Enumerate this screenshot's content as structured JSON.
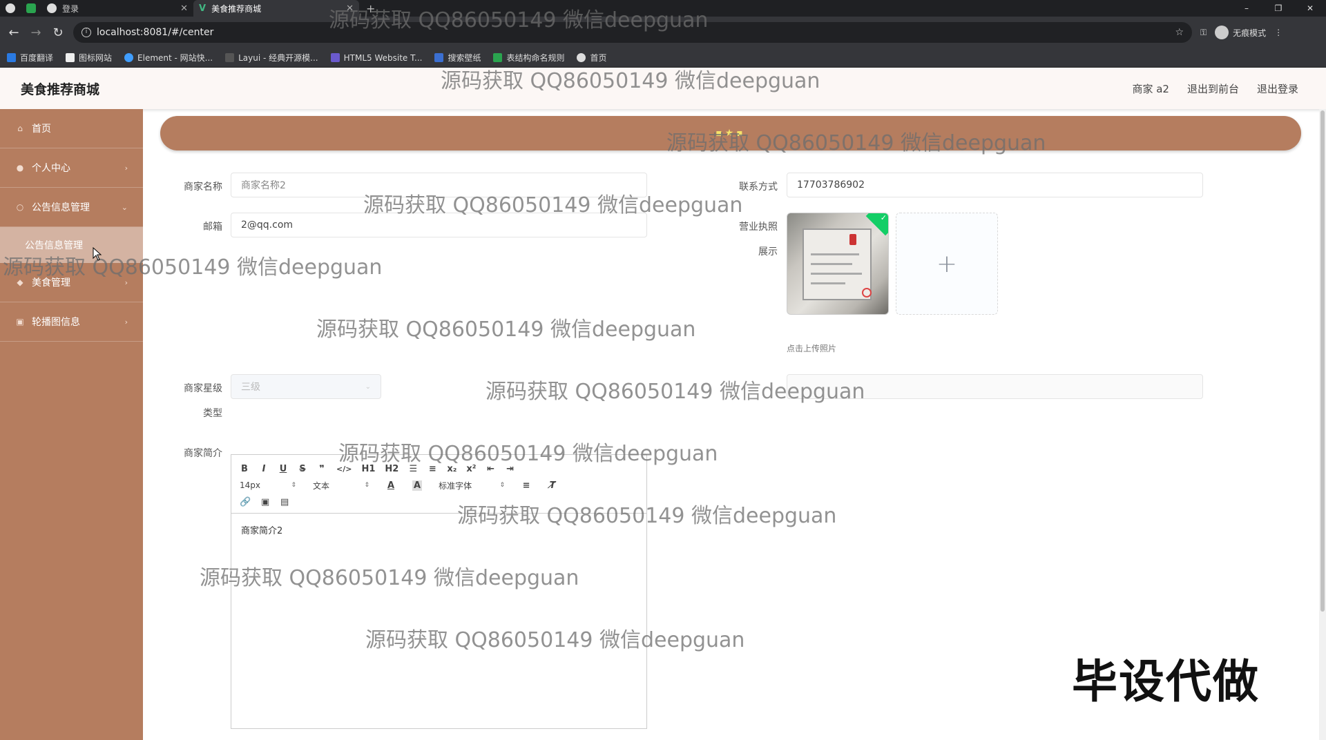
{
  "browser": {
    "tabs": [
      {
        "label": "",
        "icon": "browser-icon"
      },
      {
        "label": "",
        "icon": "sheet-icon"
      },
      {
        "label": "登录",
        "icon": "globe-icon"
      },
      {
        "label": "美食推荐商城",
        "icon": "vue-icon",
        "active": true
      }
    ],
    "new_tab": "+",
    "window_controls": [
      "–",
      "❐",
      "✕"
    ],
    "url": "localhost:8081/#/center",
    "incognito_label": "无痕模式",
    "bookmarks": [
      "百度翻译",
      "图标网站",
      "Element - 网站快...",
      "Layui - 经典开源模...",
      "HTML5 Website T...",
      "搜索壁纸",
      "表结构命名规则",
      "首页"
    ]
  },
  "app": {
    "title": "美食推荐商城",
    "header_links": [
      "商家 a2",
      "退出到前台",
      "退出登录"
    ]
  },
  "sidebar": {
    "items": [
      {
        "label": "首页",
        "icon": "home-icon"
      },
      {
        "label": "个人中心",
        "icon": "user-icon"
      },
      {
        "label": "公告信息管理",
        "icon": "notice-icon"
      },
      {
        "label": "公告信息管理",
        "sub": true
      },
      {
        "label": "美食管理",
        "icon": "food-icon"
      },
      {
        "label": "轮播图信息",
        "icon": "image-icon"
      }
    ]
  },
  "form": {
    "merchant_name_label": "商家名称",
    "merchant_name_value": "商家名称2",
    "contact_label": "联系方式",
    "contact_value": "17703786902",
    "email_label": "邮箱",
    "email_value": "2@qq.com",
    "license_label_1": "营业执照",
    "license_label_2": "展示",
    "upload_tip": "点击上传照片",
    "level_label_1": "商家星级",
    "level_label_2": "类型",
    "level_value": "三级",
    "intro_label": "商家简介",
    "intro_content": "商家简介2"
  },
  "editor": {
    "row1": [
      "B",
      "I",
      "U",
      "S",
      "❞",
      "</>",
      "H1",
      "H2",
      "☰",
      "≡",
      "x₂",
      "x²",
      "⇤",
      "⇥"
    ],
    "font_size": "14px",
    "text_type": "文本",
    "font_family": "标准字体",
    "row3": [
      "🔗",
      "▣",
      "▤"
    ]
  },
  "watermark": "源码获取 QQ86050149 微信deepguan",
  "bigmark": "毕设代做",
  "colors": {
    "primary": "#b57d5f",
    "sidebar_sub": "#d4b3a2",
    "header_bg": "#fcf7f5"
  }
}
